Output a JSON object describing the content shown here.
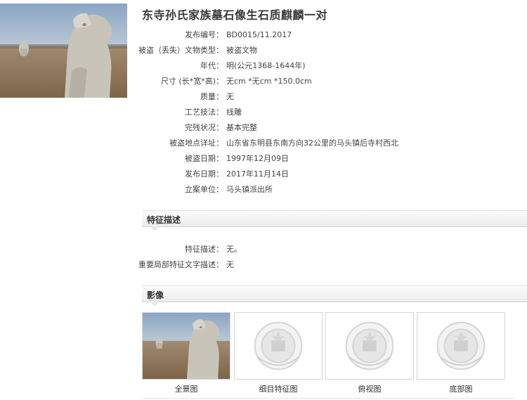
{
  "title": "东寺孙氏家族墓石像生石质麒麟一对",
  "info": [
    {
      "label": "发布编号：",
      "value": "BD0015/11.2017"
    },
    {
      "label": "被盗（丢失）文物类型：",
      "value": "被盗文物"
    },
    {
      "label": "年代：",
      "value": "明(公元1368-1644年)"
    },
    {
      "label": "尺寸 (长*宽*高)：",
      "value": "无cm *无cm *150.0cm"
    },
    {
      "label": "质量：",
      "value": "无"
    },
    {
      "label": "工艺技法：",
      "value": "线雕"
    },
    {
      "label": "完残状况：",
      "value": "基本完整"
    },
    {
      "label": "被盗地点详址：",
      "value": "山东省东明县东南方向32公里的马头镇后寺村西北"
    },
    {
      "label": "被盗日期：",
      "value": "1997年12月09日"
    },
    {
      "label": "发布日期：",
      "value": "2017年11月14日"
    },
    {
      "label": "立案单位：",
      "value": "马头镇派出所"
    }
  ],
  "features": {
    "heading": "特征描述",
    "rows": [
      {
        "label": "特征描述：",
        "value": "无。"
      },
      {
        "label": "重要局部特征文字描述：",
        "value": "无"
      }
    ]
  },
  "images": {
    "heading": "影像",
    "thumbs": [
      {
        "label": "全景图",
        "kind": "photo"
      },
      {
        "label": "细目特征图",
        "kind": "emblem-placeholder"
      },
      {
        "label": "俯视图",
        "kind": "emblem-placeholder"
      },
      {
        "label": "底部图",
        "kind": "emblem-placeholder"
      }
    ]
  }
}
